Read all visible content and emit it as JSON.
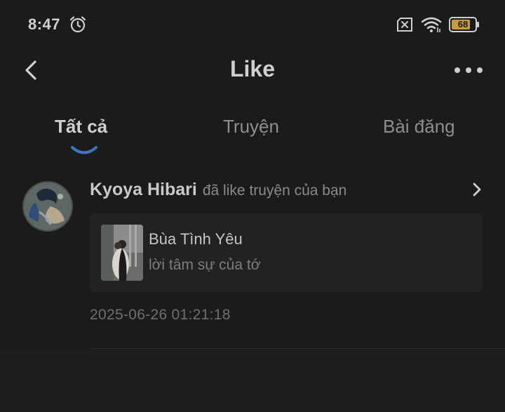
{
  "status_bar": {
    "time": "8:47",
    "battery_level": "68",
    "icons": [
      "alarm-icon",
      "no-sim-icon",
      "wifi-icon",
      "battery-icon"
    ]
  },
  "header": {
    "title": "Like",
    "back_icon": "chevron-left-icon",
    "more_icon": "more-horizontal-icon"
  },
  "tabs": [
    {
      "label": "Tất cả",
      "active": true
    },
    {
      "label": "Truyện",
      "active": false
    },
    {
      "label": "Bài đăng",
      "active": false
    }
  ],
  "notifications": [
    {
      "user_name": "Kyoya Hibari",
      "action": "đã like truyện của bạn",
      "story_title": "Bùa Tình Yêu",
      "story_subtitle": "lời tâm sự của tớ",
      "timestamp": "2025-06-26 01:21:18"
    }
  ],
  "colors": {
    "background": "#1b1b1c",
    "card": "#222223",
    "accent": "#3a78c6",
    "battery_fill": "#c79a3a"
  }
}
